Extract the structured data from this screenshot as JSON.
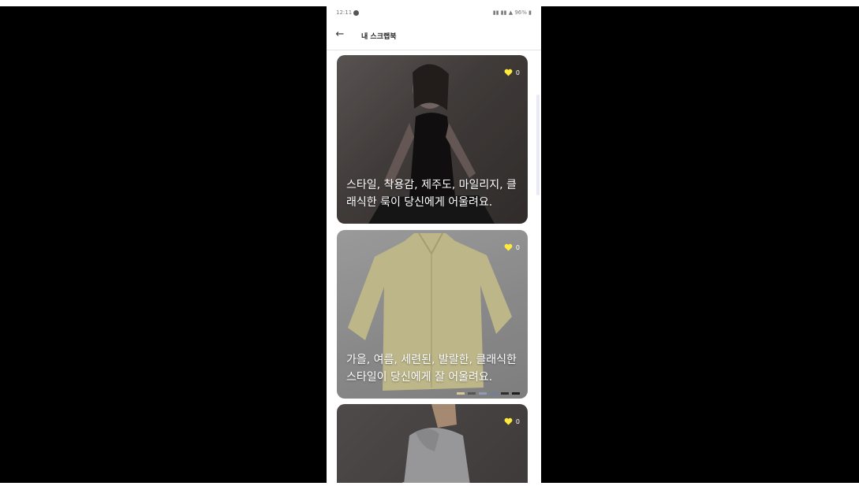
{
  "status_bar": {
    "time": "12:11",
    "right_icons_text": "96%"
  },
  "header": {
    "title": "내 스크랩북"
  },
  "cards": [
    {
      "text": "스타일, 착용감, 제주도, 마일리지, 클래식한 룩이 당신에게 어울려요.",
      "like_count": "0"
    },
    {
      "text": "가을, 여름, 세련된, 발랄한, 클래식한 스타일이 당신에게 잘 어울려요.",
      "like_count": "0",
      "swatches": [
        "#d8c89a",
        "#555555",
        "#8f9bb8",
        "#6f7fa0",
        "#2d2d2d",
        "#1e1e1e"
      ]
    },
    {
      "text": "",
      "like_count": "0"
    }
  ],
  "colors": {
    "heart": "#FFEB3B",
    "background": "#000000"
  }
}
